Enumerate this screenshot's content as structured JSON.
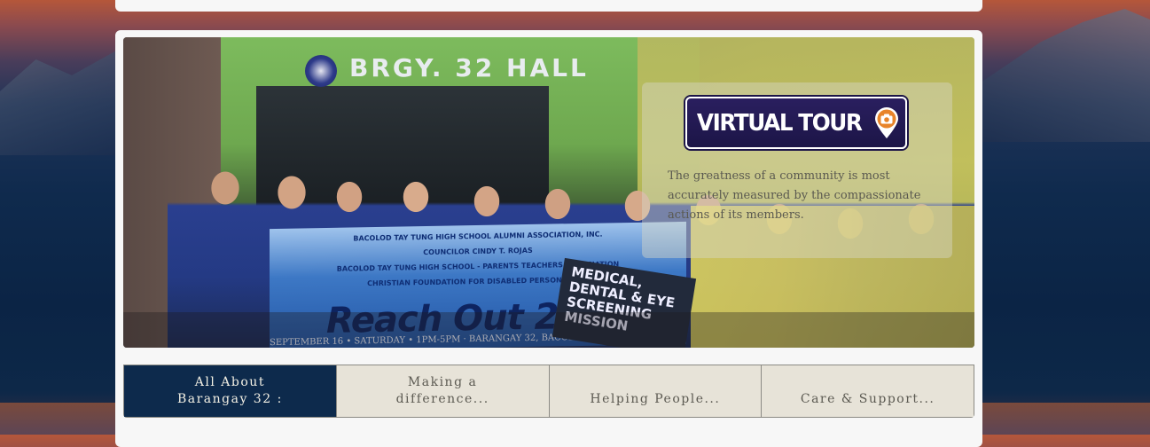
{
  "hero": {
    "building_sign": "BRGY. 32 HALL",
    "banner": {
      "line1": "BACOLOD TAY TUNG HIGH SCHOOL ALUMNI ASSOCIATION, INC.",
      "line2": "COUNCILOR CINDY T. ROJAS",
      "line3": "BACOLOD TAY TUNG HIGH SCHOOL - PARENTS TEACHERS ASSOCIATION",
      "line4": "CHRISTIAN FOUNDATION FOR DISABLED PERSONS, INC.",
      "title": "Reach Out 2017",
      "footer": "SEPTEMBER 16 • SATURDAY • 1PM-5PM · BARANGAY 32, BACOLOD CITY"
    },
    "mission_sign": "MEDICAL, DENTAL & EYE SCREENING MISSION"
  },
  "virtual_tour": {
    "label": "VIRTUAL TOUR",
    "icon": "camera-pin-icon",
    "accent_color": "#e8842a"
  },
  "quote": "The greatness of a community is most accurately measured by the compassionate actions of its members.",
  "tabs": [
    {
      "label": "All About Barangay 32 :",
      "active": true
    },
    {
      "label": "Making a difference...",
      "active": false
    },
    {
      "label": "Helping People...",
      "active": false
    },
    {
      "label": "Care & Support...",
      "active": false
    }
  ],
  "colors": {
    "active_tab": "#0d2a4c",
    "inactive_tab": "#e7e3d8",
    "card": "#f7f7f7"
  }
}
